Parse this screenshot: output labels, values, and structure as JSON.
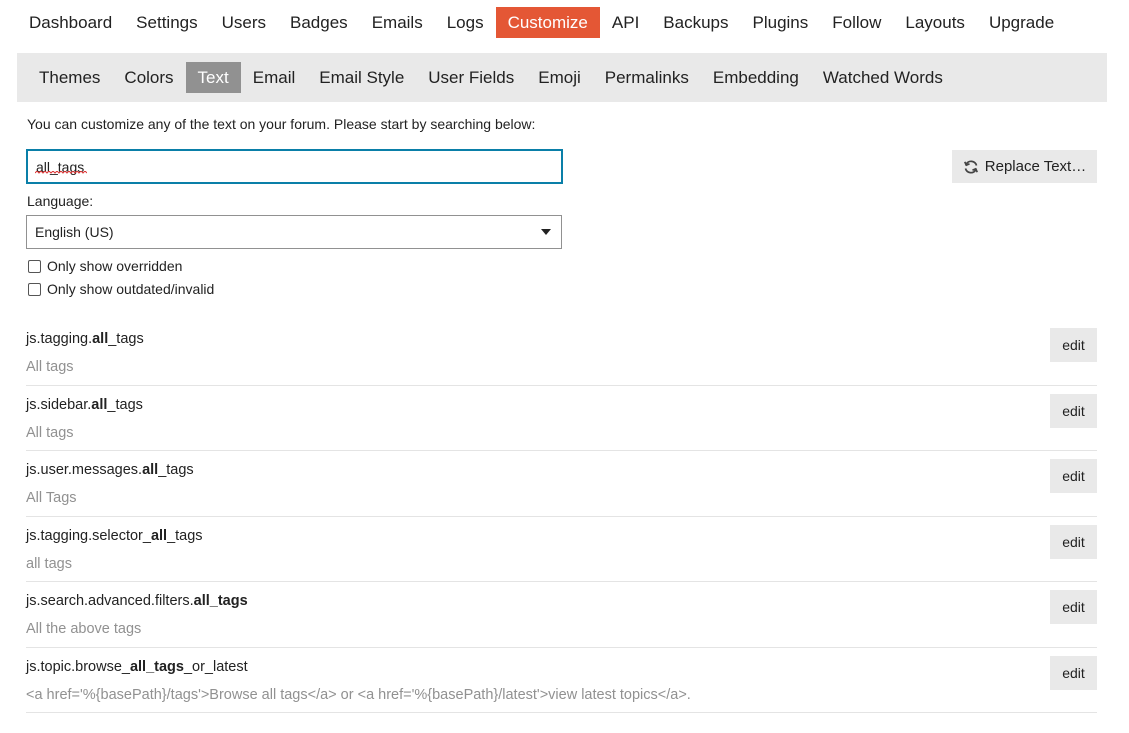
{
  "main_nav": {
    "items": [
      {
        "label": "Dashboard"
      },
      {
        "label": "Settings"
      },
      {
        "label": "Users"
      },
      {
        "label": "Badges"
      },
      {
        "label": "Emails"
      },
      {
        "label": "Logs"
      },
      {
        "label": "Customize",
        "active": true
      },
      {
        "label": "API"
      },
      {
        "label": "Backups"
      },
      {
        "label": "Plugins"
      },
      {
        "label": "Follow"
      },
      {
        "label": "Layouts"
      },
      {
        "label": "Upgrade"
      }
    ],
    "active_color": "#e45735"
  },
  "sub_nav": {
    "items": [
      {
        "label": "Themes"
      },
      {
        "label": "Colors"
      },
      {
        "label": "Text",
        "active": true
      },
      {
        "label": "Email"
      },
      {
        "label": "Email Style"
      },
      {
        "label": "User Fields"
      },
      {
        "label": "Emoji"
      },
      {
        "label": "Permalinks"
      },
      {
        "label": "Embedding"
      },
      {
        "label": "Watched Words"
      }
    ],
    "active_color": "#919191"
  },
  "intro_text": "You can customize any of the text on your forum. Please start by searching below:",
  "search": {
    "value": "all_tags",
    "focus_color": "#0a7fa8"
  },
  "replace_button": {
    "label": "Replace Text…",
    "icon": "sync-icon"
  },
  "language": {
    "label": "Language:",
    "selected": "English (US)"
  },
  "filters": {
    "only_overridden": {
      "label": "Only show overridden",
      "checked": false
    },
    "only_outdated": {
      "label": "Only show outdated/invalid",
      "checked": false
    }
  },
  "results": [
    {
      "key_prefix": "js.tagging.",
      "key_bold": "all",
      "key_suffix": "_tags",
      "value": "All tags",
      "edit_label": "edit"
    },
    {
      "key_prefix": "js.sidebar.",
      "key_bold": "all",
      "key_suffix": "_tags",
      "value": "All tags",
      "edit_label": "edit"
    },
    {
      "key_prefix": "js.user.messages.",
      "key_bold": "all",
      "key_suffix": "_tags",
      "value": "All Tags",
      "edit_label": "edit"
    },
    {
      "key_prefix": "js.tagging.selector_",
      "key_bold": "all",
      "key_suffix": "_tags",
      "value": "all tags",
      "edit_label": "edit"
    },
    {
      "key_prefix": "js.search.advanced.filters.",
      "key_bold": "all_tags",
      "key_suffix": "",
      "value": "All the above tags",
      "edit_label": "edit"
    },
    {
      "key_prefix": "js.topic.browse_",
      "key_bold": "all_tags",
      "key_suffix": "_or_latest",
      "value": "<a href='%{basePath}/tags'>Browse all tags</a> or <a href='%{basePath}/latest'>view latest topics</a>.",
      "edit_label": "edit"
    }
  ]
}
